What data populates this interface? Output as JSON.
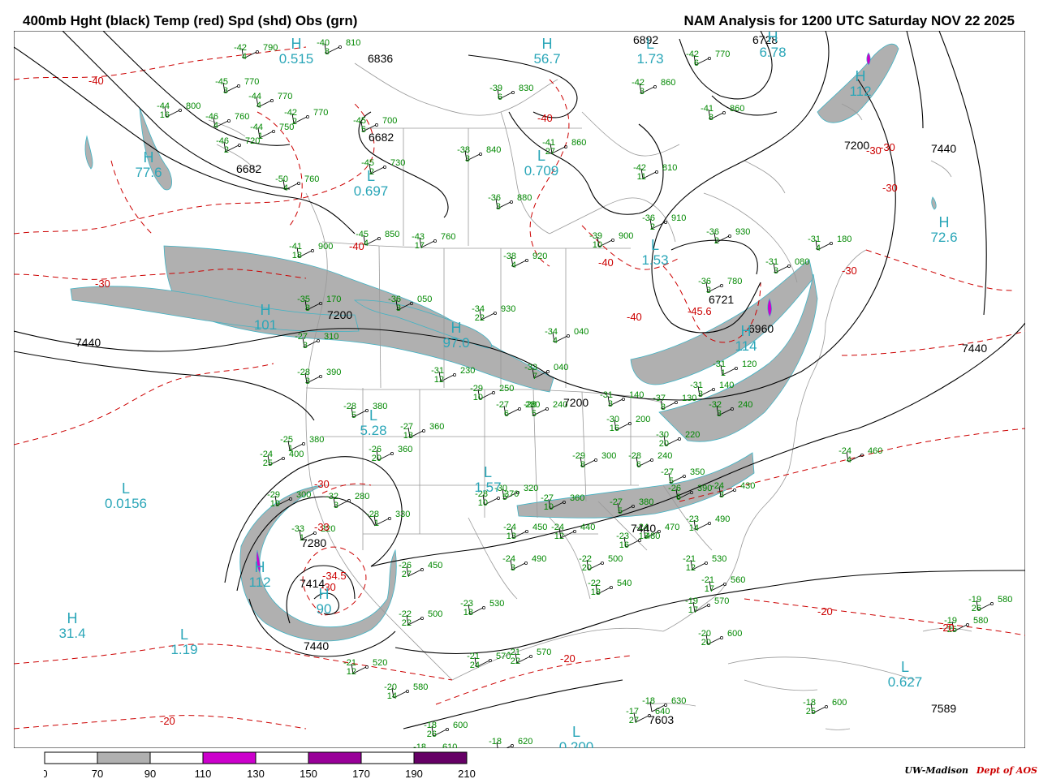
{
  "header": {
    "left_title": "400mb Hght (black) Temp (red) Spd (shd) Obs (grn)",
    "right_title": "NAM Analysis for 1200 UTC Saturday  NOV 22 2025"
  },
  "colors": {
    "height_contour": "#000000",
    "temperature_contour": "#cc0000",
    "speed_70_90": "#b0b0b0",
    "speed_110_130": "#cc00cc",
    "speed_150_170": "#990099",
    "speed_190_210": "#660066",
    "center_label": "#2aa6b8",
    "observation": "#008800",
    "geography": "#999999"
  },
  "height_labels": [
    "6836",
    "6682",
    "6682",
    "6892",
    "6728",
    "7200",
    "7440",
    "7440",
    "7440",
    "7200",
    "7200",
    "6721",
    "7440",
    "7440",
    "7603",
    "7589",
    "7414",
    "7280",
    "6960"
  ],
  "temperature_labels": [
    "-40",
    "-30",
    "-40",
    "-30",
    "-40",
    "-40",
    "-30",
    "-45.6",
    "-30",
    "-40",
    "-30",
    "-20",
    "-20",
    "-20",
    "-20",
    "-30",
    "-34.5",
    "-30",
    "-33"
  ],
  "pressure_centers": [
    {
      "letter": "H",
      "value": "0.515"
    },
    {
      "letter": "L",
      "value": "0.697"
    },
    {
      "letter": "H",
      "value": "77.6"
    },
    {
      "letter": "L",
      "value": "1.73"
    },
    {
      "letter": "H",
      "value": "56.7"
    },
    {
      "letter": "L",
      "value": "0.709"
    },
    {
      "letter": "L",
      "value": "1.53"
    },
    {
      "letter": "H",
      "value": "101"
    },
    {
      "letter": "H",
      "value": "97.0"
    },
    {
      "letter": "L",
      "value": "5.28"
    },
    {
      "letter": "H",
      "value": "72.6"
    },
    {
      "letter": "H",
      "value": "112"
    },
    {
      "letter": "L",
      "value": "0.0156"
    },
    {
      "letter": "L",
      "value": "1.57"
    },
    {
      "letter": "H",
      "value": "31.4"
    },
    {
      "letter": "L",
      "value": "1.19"
    },
    {
      "letter": "L",
      "value": "0.627"
    },
    {
      "letter": "L",
      "value": "0.200"
    },
    {
      "letter": "H",
      "value": "114"
    },
    {
      "letter": "H",
      "value": "90"
    },
    {
      "letter": "H",
      "value": "112"
    },
    {
      "letter": "H",
      "value": "6.78"
    }
  ],
  "observations": [
    {
      "temp": "-42",
      "hgt": "790",
      "dep": "4"
    },
    {
      "temp": "-40",
      "hgt": "810",
      "dep": "8"
    },
    {
      "temp": "-45",
      "hgt": "770",
      "dep": "3"
    },
    {
      "temp": "-44",
      "hgt": "770",
      "dep": "4"
    },
    {
      "temp": "-44",
      "hgt": "800",
      "dep": "16"
    },
    {
      "temp": "-46",
      "hgt": "760",
      "dep": "4"
    },
    {
      "temp": "-42",
      "hgt": "770",
      "dep": "2"
    },
    {
      "temp": "-44",
      "hgt": "750",
      "dep": "1"
    },
    {
      "temp": "-46",
      "hgt": "720",
      "dep": "2"
    },
    {
      "temp": "-45",
      "hgt": "700",
      "dep": "5"
    },
    {
      "temp": "-45",
      "hgt": "730",
      "dep": "2"
    },
    {
      "temp": "-50",
      "hgt": "760",
      "dep": "4"
    },
    {
      "temp": "-39",
      "hgt": "830",
      "dep": "6"
    },
    {
      "temp": "-38",
      "hgt": "840",
      "dep": "3"
    },
    {
      "temp": "-41",
      "hgt": "860",
      "dep": "27"
    },
    {
      "temp": "-42",
      "hgt": "860",
      "dep": "3"
    },
    {
      "temp": "-42",
      "hgt": "770",
      "dep": "6"
    },
    {
      "temp": "-41",
      "hgt": "860",
      "dep": "8"
    },
    {
      "temp": "-42",
      "hgt": "810",
      "dep": "11"
    },
    {
      "temp": "-36",
      "hgt": "880",
      "dep": "3"
    },
    {
      "temp": "-36",
      "hgt": "910",
      "dep": "2"
    },
    {
      "temp": "-36",
      "hgt": "930",
      "dep": "2"
    },
    {
      "temp": "-31",
      "hgt": "180",
      "dep": "4"
    },
    {
      "temp": "-45",
      "hgt": "850",
      "dep": "4"
    },
    {
      "temp": "-43",
      "hgt": "760",
      "dep": "17"
    },
    {
      "temp": "-39",
      "hgt": "900",
      "dep": "10"
    },
    {
      "temp": "-38",
      "hgt": "920",
      "dep": "4"
    },
    {
      "temp": "-41",
      "hgt": "900",
      "dep": "18"
    },
    {
      "temp": "-36",
      "hgt": "780",
      "dep": "3"
    },
    {
      "temp": "-31",
      "hgt": "080",
      "dep": "3"
    },
    {
      "temp": "-35",
      "hgt": "170",
      "dep": "8"
    },
    {
      "temp": "-36",
      "hgt": "050",
      "dep": "3"
    },
    {
      "temp": "-34",
      "hgt": "930",
      "dep": "22"
    },
    {
      "temp": "-34",
      "hgt": "040",
      "dep": "4"
    },
    {
      "temp": "-33",
      "hgt": "040",
      "dep": "7"
    },
    {
      "temp": "-31",
      "hgt": "230",
      "dep": "12"
    },
    {
      "temp": "-31",
      "hgt": "120",
      "dep": "1"
    },
    {
      "temp": "-29",
      "hgt": "250",
      "dep": "10"
    },
    {
      "temp": "-27",
      "hgt": "280",
      "dep": "6"
    },
    {
      "temp": "-28",
      "hgt": "240",
      "dep": "5"
    },
    {
      "temp": "-31",
      "hgt": "140",
      "dep": "3"
    },
    {
      "temp": "-31",
      "hgt": "140",
      "dep": "3"
    },
    {
      "temp": "-32",
      "hgt": "240",
      "dep": "3"
    },
    {
      "temp": "-37",
      "hgt": "130",
      "dep": "8"
    },
    {
      "temp": "-27",
      "hgt": "310",
      "dep": "3"
    },
    {
      "temp": "-28",
      "hgt": "390",
      "dep": "3"
    },
    {
      "temp": "-28",
      "hgt": "380",
      "dep": "5"
    },
    {
      "temp": "-27",
      "hgt": "360",
      "dep": "13"
    },
    {
      "temp": "-25",
      "hgt": "380",
      "dep": "1"
    },
    {
      "temp": "-24",
      "hgt": "400",
      "dep": "25"
    },
    {
      "temp": "-26",
      "hgt": "360",
      "dep": "20"
    },
    {
      "temp": "-29",
      "hgt": "300",
      "dep": "8"
    },
    {
      "temp": "-28",
      "hgt": "240",
      "dep": "6"
    },
    {
      "temp": "-30",
      "hgt": "200",
      "dep": "16"
    },
    {
      "temp": "-30",
      "hgt": "220",
      "dep": "20"
    },
    {
      "temp": "-27",
      "hgt": "350",
      "dep": "5"
    },
    {
      "temp": "-26",
      "hgt": "390",
      "dep": "6"
    },
    {
      "temp": "-24",
      "hgt": "430",
      "dep": "3"
    },
    {
      "temp": "-24",
      "hgt": "460",
      "dep": "4"
    },
    {
      "temp": "-29",
      "hgt": "300",
      "dep": "19"
    },
    {
      "temp": "-32",
      "hgt": "280",
      "dep": "3"
    },
    {
      "temp": "-28",
      "hgt": "330",
      "dep": "1"
    },
    {
      "temp": "-33",
      "hgt": "220",
      "dep": "1"
    },
    {
      "temp": "-30",
      "hgt": "320",
      "dep": "5"
    },
    {
      "temp": "-28",
      "hgt": "370",
      "dep": "10"
    },
    {
      "temp": "-27",
      "hgt": "360",
      "dep": "10"
    },
    {
      "temp": "-27",
      "hgt": "380",
      "dep": "5"
    },
    {
      "temp": "-24",
      "hgt": "450",
      "dep": "13"
    },
    {
      "temp": "-24",
      "hgt": "440",
      "dep": "12"
    },
    {
      "temp": "-24",
      "hgt": "470",
      "dep": "13"
    },
    {
      "temp": "-23",
      "hgt": "490",
      "dep": "14"
    },
    {
      "temp": "-23",
      "hgt": "480",
      "dep": "16"
    },
    {
      "temp": "-24",
      "hgt": "490",
      "dep": "3"
    },
    {
      "temp": "-22",
      "hgt": "500",
      "dep": "20"
    },
    {
      "temp": "-22",
      "hgt": "540",
      "dep": "18"
    },
    {
      "temp": "-21",
      "hgt": "530",
      "dep": "12"
    },
    {
      "temp": "-21",
      "hgt": "560",
      "dep": "17"
    },
    {
      "temp": "-19",
      "hgt": "570",
      "dep": "17"
    },
    {
      "temp": "-20",
      "hgt": "600",
      "dep": "20"
    },
    {
      "temp": "-26",
      "hgt": "450",
      "dep": "27"
    },
    {
      "temp": "-22",
      "hgt": "500",
      "dep": "22"
    },
    {
      "temp": "-23",
      "hgt": "530",
      "dep": "18"
    },
    {
      "temp": "-21",
      "hgt": "570",
      "dep": "24"
    },
    {
      "temp": "-21",
      "hgt": "570",
      "dep": "22"
    },
    {
      "temp": "-21",
      "hgt": "520",
      "dep": "12"
    },
    {
      "temp": "-20",
      "hgt": "580",
      "dep": "14"
    },
    {
      "temp": "-18",
      "hgt": "600",
      "dep": "26"
    },
    {
      "temp": "-18",
      "hgt": "610",
      "dep": ""
    },
    {
      "temp": "-18",
      "hgt": "620",
      "dep": ""
    },
    {
      "temp": "-17",
      "hgt": "640",
      "dep": "27"
    },
    {
      "temp": "-18",
      "hgt": "630",
      "dep": ""
    },
    {
      "temp": "-18",
      "hgt": "600",
      "dep": "25"
    },
    {
      "temp": "-19",
      "hgt": "580",
      "dep": "25"
    },
    {
      "temp": "-19",
      "hgt": "580",
      "dep": "26"
    }
  ],
  "legend": {
    "ticks": [
      "0",
      "70",
      "90",
      "110",
      "130",
      "150",
      "170",
      "190",
      "210"
    ]
  },
  "footer": {
    "org": "UW-Madison",
    "dept": "Dept of AOS"
  }
}
